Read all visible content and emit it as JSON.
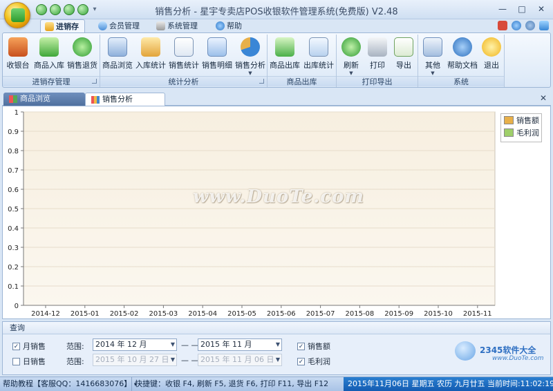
{
  "window": {
    "title": "销售分析 - 星宇专卖店POS收银软件管理系统(免费版) V2.48",
    "min": "—",
    "max": "□",
    "close": "✕"
  },
  "ribbon_tabs": [
    {
      "label": "进销存",
      "active": true
    },
    {
      "label": "会员管理",
      "active": false
    },
    {
      "label": "系统管理",
      "active": false
    },
    {
      "label": "帮助",
      "active": false
    }
  ],
  "ribbon_groups": [
    {
      "label": "进销存管理",
      "buttons": [
        "收银台",
        "商品入库",
        "销售退货"
      ]
    },
    {
      "label": "统计分析",
      "buttons": [
        "商品浏览",
        "入库统计",
        "销售统计",
        "销售明细",
        "销售分析"
      ]
    },
    {
      "label": "商品出库",
      "buttons": [
        "商品出库",
        "出库统计"
      ]
    },
    {
      "label": "打印导出",
      "buttons": [
        "刷新",
        "打印",
        "导出"
      ]
    },
    {
      "label": "系统",
      "buttons": [
        "其他",
        "帮助文档",
        "退出"
      ]
    }
  ],
  "doc_tabs": [
    {
      "label": "商品浏览",
      "active": false
    },
    {
      "label": "销售分析",
      "active": true
    }
  ],
  "chart_data": {
    "type": "bar",
    "categories": [
      "2014-12",
      "2015-01",
      "2015-02",
      "2015-03",
      "2015-04",
      "2015-05",
      "2015-06",
      "2015-07",
      "2015-08",
      "2015-09",
      "2015-10",
      "2015-11"
    ],
    "series": [
      {
        "name": "销售额",
        "values": [
          0,
          0,
          0,
          0,
          0,
          0,
          0,
          0,
          0,
          0,
          0,
          0
        ],
        "color": "#e8b04a"
      },
      {
        "name": "毛利润",
        "values": [
          0,
          0,
          0,
          0,
          0,
          0,
          0,
          0,
          0,
          0,
          0,
          0
        ],
        "color": "#9fcf6a"
      }
    ],
    "yticks": [
      "0",
      "0.1",
      "0.2",
      "0.3",
      "0.4",
      "0.5",
      "0.6",
      "0.7",
      "0.8",
      "0.9",
      "1"
    ],
    "ylim": [
      0,
      1
    ],
    "legend": "top-right",
    "grid": true
  },
  "watermark": "www.DuoTe.com",
  "query": {
    "title": "查询",
    "monthly_label": "月销售",
    "monthly_checked": true,
    "daily_label": "日销售",
    "daily_checked": false,
    "range_label": "范围:",
    "month_from": "2014 年 12 月",
    "month_to": "2015 年 11 月",
    "day_from": "2015 年 10 月 27 日",
    "day_to": "2015 年 11 月 06 日",
    "dash": "— —",
    "sales_label": "销售额",
    "profit_label": "毛利润",
    "check_mark": "✓"
  },
  "brand_logo": {
    "text": "2345软件大全",
    "site": "www.DuoTe.com"
  },
  "statusbar": {
    "help": "帮助教程【客服QQ：1416683076】",
    "shortcuts": "快捷键：收银 F4, 刷新 F5, 退货 F6, 打印 F11, 导出 F12",
    "datetime": "2015年11月06日 星期五 农历 九月廿五 当前时间:11:02:19"
  }
}
